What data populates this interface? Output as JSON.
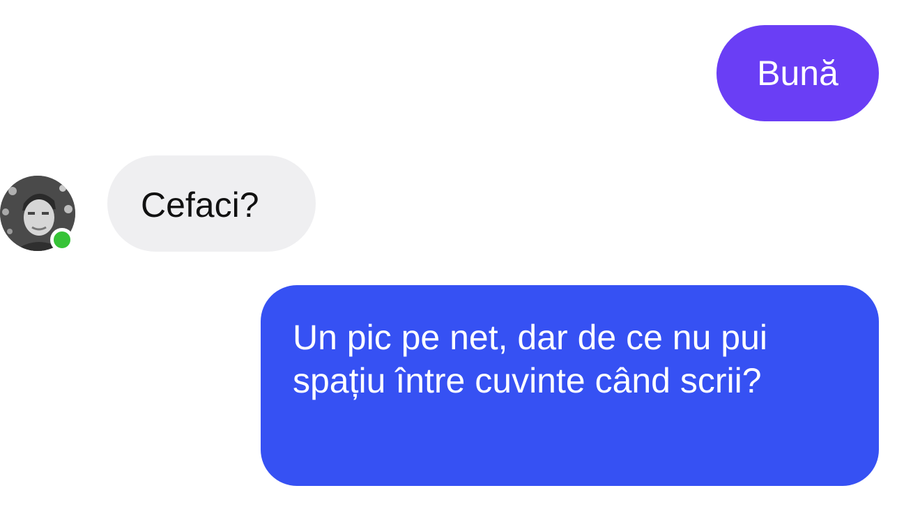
{
  "conversation": {
    "messages": [
      {
        "sender": "me",
        "text": "Bună"
      },
      {
        "sender": "contact",
        "text": "Cefaci?"
      },
      {
        "sender": "me",
        "text": "Un pic pe net, dar de ce nu pui spațiu între cuvinte când scrii?"
      }
    ],
    "contact": {
      "avatar_icon": "person-photo-icon",
      "online": true
    }
  },
  "colors": {
    "outgoing_first": "#6a3ef5",
    "outgoing_second": "#3651f3",
    "incoming_bubble": "#efeff1",
    "online_dot": "#36c337",
    "background": "#ffffff"
  }
}
